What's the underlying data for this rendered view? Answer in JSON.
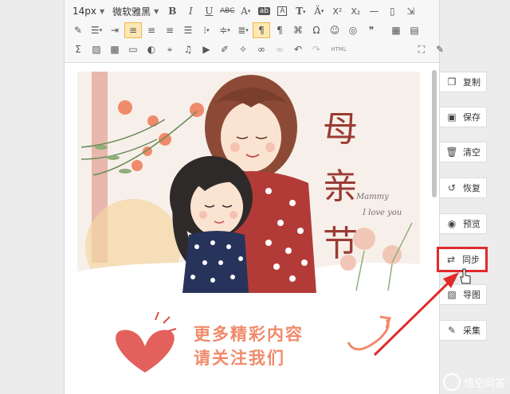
{
  "toolbar": {
    "font_size": "14px",
    "font_family": "微软雅黑",
    "row1_icons": [
      "bold-icon",
      "italic-icon",
      "underline-icon",
      "strikethrough-icon",
      "font-color-icon",
      "background-color-icon",
      "border-text-icon",
      "font-style-icon",
      "text-shadow-icon",
      "superscript-icon",
      "subscript-icon",
      "horizontal-rule-icon",
      "blank-page-icon",
      "clear-format-icon"
    ],
    "row2_icons": [
      "eraser-icon",
      "line-height-icon",
      "indent-icon",
      "align-left-icon",
      "align-center-icon",
      "align-right-icon",
      "align-justify-icon",
      "list-style-icon",
      "paragraph-spacing-icon",
      "row-spacing-icon",
      "direction-ltr-icon",
      "direction-rtl-icon",
      "insert-code-icon",
      "special-char-icon",
      "emoji-icon",
      "search-replace-icon",
      "quote-icon",
      "table-icon",
      "page-break-icon"
    ],
    "row3_icons": [
      "formula-icon",
      "image-icon",
      "multi-image-icon",
      "video-icon",
      "background-icon",
      "map-icon",
      "music-icon",
      "insert-video-icon",
      "attachment-icon",
      "template-icon",
      "link-icon",
      "unlink-icon",
      "undo-icon",
      "redo-icon",
      "html-icon",
      "fullscreen-icon",
      "preview-icon"
    ],
    "html_label": "HTML"
  },
  "poster": {
    "title_chars": [
      "母",
      "亲",
      "节"
    ],
    "script_line1": "Mammy",
    "script_line2": "I love you"
  },
  "promo": {
    "line1": "更多精彩内容",
    "line2": "请关注我们"
  },
  "side_buttons": [
    {
      "label": "复制",
      "icon": "copy-icon"
    },
    {
      "label": "保存",
      "icon": "save-icon"
    },
    {
      "label": "清空",
      "icon": "trash-icon"
    },
    {
      "label": "恢复",
      "icon": "restore-icon"
    },
    {
      "label": "预览",
      "icon": "eye-icon"
    },
    {
      "label": "同步",
      "icon": "sync-icon"
    },
    {
      "label": "导图",
      "icon": "export-image-icon"
    },
    {
      "label": "采集",
      "icon": "collect-icon"
    }
  ],
  "watermark": "悟空问答",
  "colors": {
    "highlight_red": "#e02b2b",
    "title_red": "#9a3b34",
    "promo_orange": "#f08a6a"
  }
}
